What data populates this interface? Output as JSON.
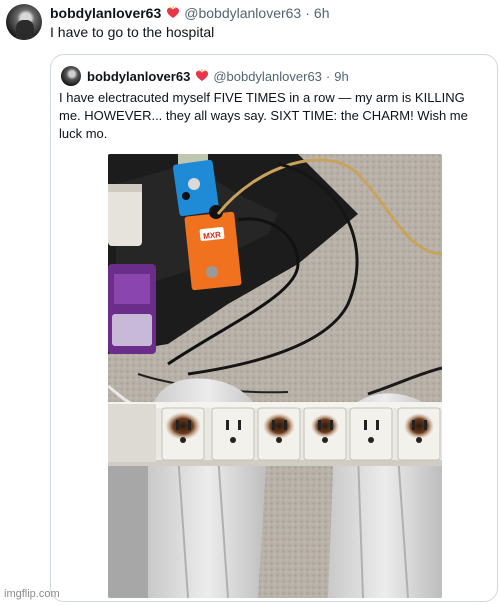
{
  "tweet": {
    "display_name": "bobdylanlover63",
    "handle": "@bobdylanlover63",
    "separator": "·",
    "time": "6h",
    "text": "I have to go to the hospital"
  },
  "quoted_tweet": {
    "display_name": "bobdylanlover63",
    "handle": "@bobdylanlover63",
    "separator": "·",
    "time": "9h",
    "text": "I have electracuted myself FIVE TIMES in a row — my arm is KILLING me. HOWEVER... they all ways say. SIXT TIME: the CHARM! Wish me luck mo."
  },
  "photo": {
    "pedal_label": "MXR"
  },
  "watermark": "imgflip.com",
  "colors": {
    "text": "#0f1419",
    "secondary": "#536471",
    "border": "#cfd9de",
    "badge": "#e8344a"
  }
}
